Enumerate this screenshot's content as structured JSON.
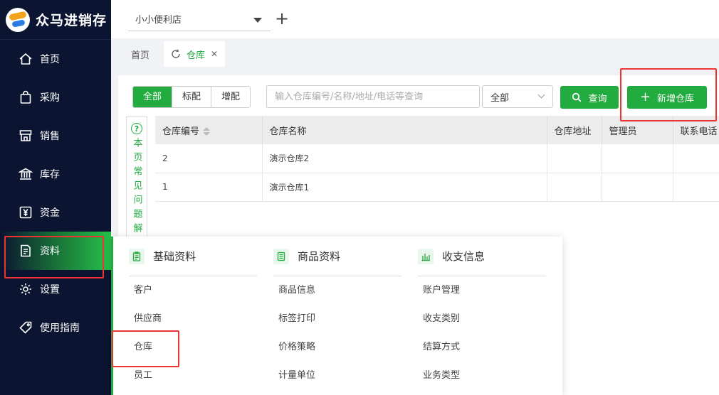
{
  "app": {
    "name": "众马进销存"
  },
  "sidebar": {
    "items": [
      {
        "label": "首页",
        "icon": "home-icon"
      },
      {
        "label": "采购",
        "icon": "shopping-bag-icon"
      },
      {
        "label": "销售",
        "icon": "store-icon"
      },
      {
        "label": "库存",
        "icon": "warehouse-bank-icon"
      },
      {
        "label": "资金",
        "icon": "yen-icon"
      },
      {
        "label": "资料",
        "icon": "document-icon",
        "active": true
      },
      {
        "label": "设置",
        "icon": "gear-icon"
      },
      {
        "label": "使用指南",
        "icon": "tag-icon"
      }
    ]
  },
  "topbar": {
    "store": "小小便利店",
    "add_icon": "plus-icon"
  },
  "tabs": [
    {
      "label": "首页"
    },
    {
      "label": "仓库",
      "active": true,
      "icon": "refresh-icon",
      "close_icon": "close-icon"
    }
  ],
  "toolbar": {
    "segments": [
      "全部",
      "标配",
      "增配"
    ],
    "selected_segment": "全部",
    "search_placeholder": "输入仓库编号/名称/地址/电话等查询",
    "filter_value": "全部",
    "query_label": "查询",
    "add_label": "新增仓库",
    "accent_color": "#22ab3f"
  },
  "faq": {
    "text": "本页常见问题解"
  },
  "table": {
    "columns": [
      "仓库编号",
      "仓库名称",
      "仓库地址",
      "管理员",
      "联系电话"
    ],
    "rows": [
      {
        "code": "2",
        "name": "演示仓库2",
        "address": "",
        "manager": "",
        "phone": ""
      },
      {
        "code": "1",
        "name": "演示仓库1",
        "address": "",
        "manager": "",
        "phone": ""
      }
    ]
  },
  "flyout": {
    "columns": [
      {
        "title": "基础资料",
        "icon": "clipboard-icon",
        "items": [
          "客户",
          "供应商",
          "仓库",
          "员工"
        ]
      },
      {
        "title": "商品资料",
        "icon": "list-icon",
        "items": [
          "商品信息",
          "标签打印",
          "价格策略",
          "计量单位"
        ]
      },
      {
        "title": "收支信息",
        "icon": "bar-chart-icon",
        "items": [
          "账户管理",
          "收支类别",
          "结算方式",
          "业务类型"
        ]
      }
    ]
  },
  "highlight_color": "#e33333"
}
